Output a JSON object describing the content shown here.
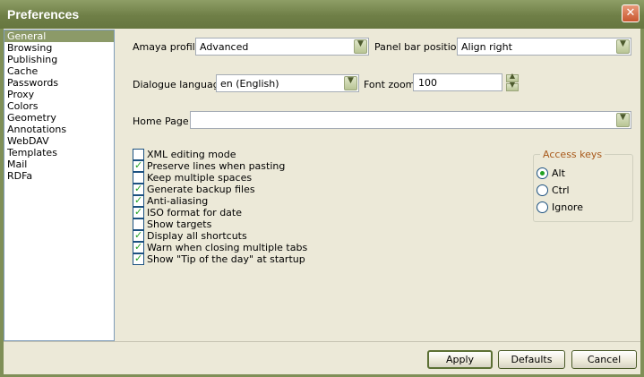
{
  "window": {
    "title": "Preferences"
  },
  "sidebar": {
    "items": [
      {
        "label": "General",
        "selected": true
      },
      {
        "label": "Browsing"
      },
      {
        "label": "Publishing"
      },
      {
        "label": "Cache"
      },
      {
        "label": "Passwords"
      },
      {
        "label": "Proxy"
      },
      {
        "label": "Colors"
      },
      {
        "label": "Geometry"
      },
      {
        "label": "Annotations"
      },
      {
        "label": "WebDAV"
      },
      {
        "label": "Templates"
      },
      {
        "label": "Mail"
      },
      {
        "label": "RDFa"
      }
    ]
  },
  "form": {
    "amaya_profile_label": "Amaya profile:",
    "amaya_profile_value": "Advanced",
    "panel_bar_label": "Panel bar position:",
    "panel_bar_value": "Align right",
    "dialogue_language_label": "Dialogue language",
    "dialogue_language_value": "en (English)",
    "font_zoom_label": "Font zoom",
    "font_zoom_value": "100",
    "home_page_label": "Home Page",
    "home_page_value": ""
  },
  "checkboxes": [
    {
      "label": "XML editing mode",
      "checked": false
    },
    {
      "label": "Preserve lines when pasting",
      "checked": true
    },
    {
      "label": "Keep multiple spaces",
      "checked": false
    },
    {
      "label": "Generate backup files",
      "checked": true
    },
    {
      "label": "Anti-aliasing",
      "checked": true
    },
    {
      "label": "ISO format for date",
      "checked": true
    },
    {
      "label": "Show targets",
      "checked": false
    },
    {
      "label": "Display all shortcuts",
      "checked": true
    },
    {
      "label": "Warn when closing multiple tabs",
      "checked": true
    },
    {
      "label": "Show \"Tip of the day\" at startup",
      "checked": true
    }
  ],
  "access_keys": {
    "title": "Access keys",
    "options": [
      {
        "label": "Alt",
        "selected": true
      },
      {
        "label": "Ctrl",
        "selected": false
      },
      {
        "label": "Ignore",
        "selected": false
      }
    ]
  },
  "buttons": {
    "apply": "Apply",
    "defaults": "Defaults",
    "cancel": "Cancel"
  },
  "icons": {
    "close": "close-icon",
    "dropdown": "chevron-down-icon",
    "check": "checkmark-icon"
  },
  "colors": {
    "titlebar": "#6f7f47",
    "selection": "#8c9a68",
    "group_title": "#a8591a",
    "check": "#21a121"
  }
}
